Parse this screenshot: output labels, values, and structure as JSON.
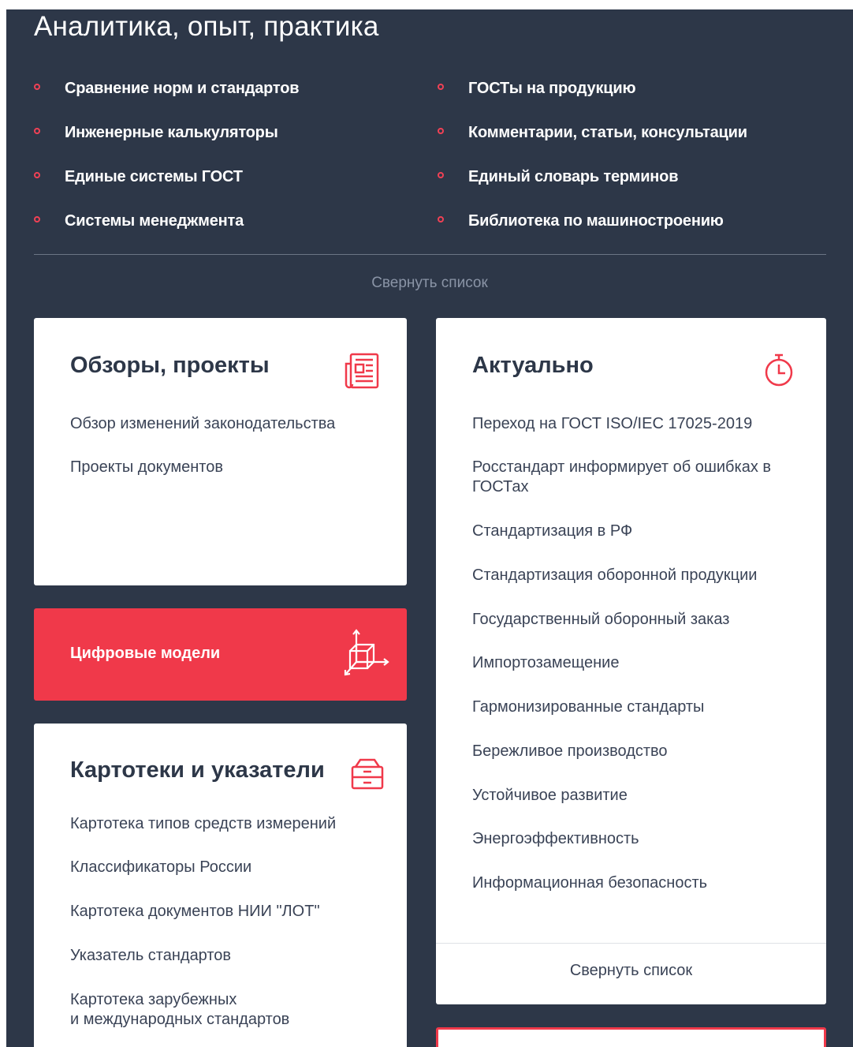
{
  "header": {
    "title": "Аналитика, опыт, практика"
  },
  "links_left": [
    "Сравнение норм и стандартов",
    "Инженерные калькуляторы",
    "Единые системы ГОСТ",
    "Системы менеджмента"
  ],
  "links_right": [
    "ГОСТы на продукцию",
    "Комментарии, статьи, консультации",
    "Единый словарь терминов",
    "Библиотека по машиностроению"
  ],
  "collapse_label": "Свернуть список",
  "reviews": {
    "title": "Обзоры, проекты",
    "icon": "newspaper-icon",
    "links": [
      "Обзор изменений законодательства",
      "Проекты документов"
    ]
  },
  "digital": {
    "label": "Цифровые модели",
    "icon": "3d-cube-icon"
  },
  "catalogs": {
    "title": "Картотеки и указатели",
    "icon": "archive-box-icon",
    "links": [
      "Картотека типов средств измерений",
      "Классификаторы России",
      "Картотека документов НИИ \"ЛОТ\"",
      "Указатель стандартов",
      "Картотека зарубежных",
      "и международных стандартов"
    ]
  },
  "actual": {
    "title": "Актуально",
    "icon": "stopwatch-icon",
    "links": [
      "Переход на ГОСТ ISO/IEC 17025-2019",
      "Росстандарт информирует об ошибках в",
      "ГОСТах",
      "Стандартизация в РФ",
      "Стандартизация оборонной продукции",
      "Государственный оборонный заказ",
      "Импортозамещение",
      "Гармонизированные стандарты",
      "Бережливое производство",
      "Устойчивое развитие",
      "Энергоэффективность",
      "Информационная безопасность"
    ],
    "footer": "Свернуть список"
  },
  "colors": {
    "background": "#2d3748",
    "accent": "#f0394a",
    "text_dark": "#3a4356"
  }
}
